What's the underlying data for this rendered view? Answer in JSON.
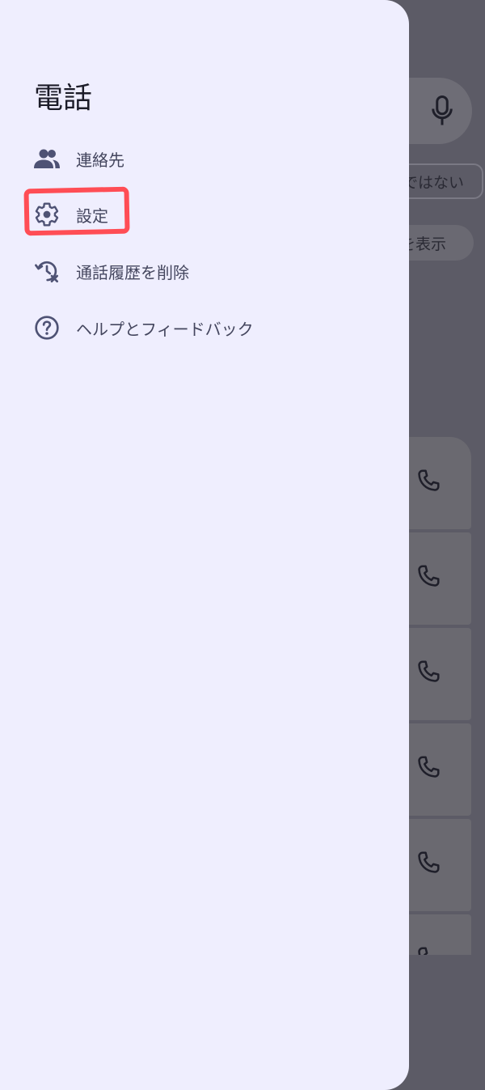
{
  "background": {
    "chips": {
      "outline_partial": "ではない",
      "filled_partial": "を表示"
    },
    "icons": {
      "mic": "mic-icon",
      "phone": "phone-icon"
    },
    "rows": [
      {
        "icon": "phone-icon"
      },
      {
        "icon": "phone-icon"
      },
      {
        "icon": "phone-icon"
      },
      {
        "icon": "phone-icon"
      },
      {
        "icon": "phone-icon"
      },
      {
        "icon": "phone-icon"
      }
    ]
  },
  "drawer": {
    "title": "電話",
    "items": [
      {
        "label": "連絡先",
        "icon": "contacts-icon"
      },
      {
        "label": "設定",
        "icon": "gear-icon"
      },
      {
        "label": "通話履歴を削除",
        "icon": "clear-history-icon"
      },
      {
        "label": "ヘルプとフィードバック",
        "icon": "help-icon"
      }
    ]
  },
  "colors": {
    "drawer_background": "#efeefe",
    "scrim": "#5c5b66",
    "icon": "#4e5274",
    "annotation": "#ff4d55"
  }
}
